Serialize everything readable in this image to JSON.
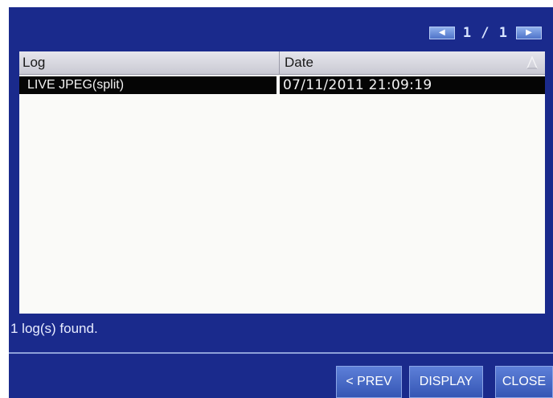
{
  "pager": {
    "prev_icon": "left-arrow-icon",
    "next_icon": "right-arrow-icon",
    "page_text": "1 / 1"
  },
  "table": {
    "columns": [
      "Log",
      "Date"
    ],
    "sort_icon": "sort-triangle-icon",
    "rows": [
      {
        "log": "LIVE JPEG(split)",
        "date": "07/11/2011 21:09:19"
      }
    ]
  },
  "status": {
    "text": "1 log(s) found."
  },
  "buttons": {
    "prev": "< PREV",
    "display": "DISPLAY",
    "close": "CLOSE"
  },
  "colors": {
    "background": "#1a2a8c",
    "selection": "#050505",
    "button": "#3f62c4"
  }
}
